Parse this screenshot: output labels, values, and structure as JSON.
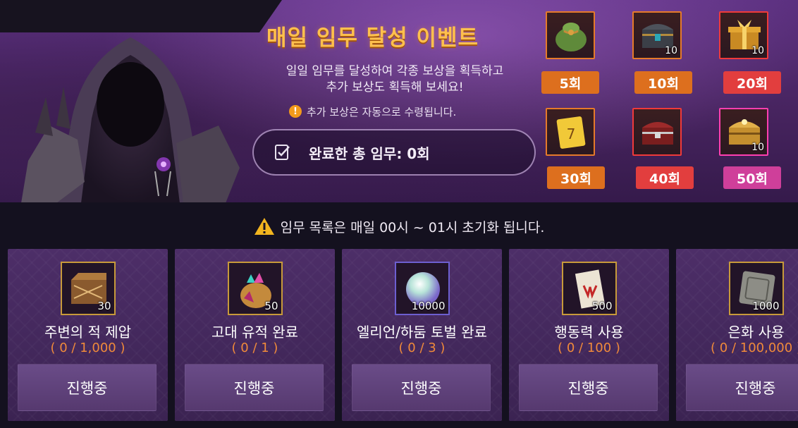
{
  "banner": {
    "title": "매일 임무 달성 이벤트",
    "description": "일일 임무를 달성하여 각종 보상을 획득하고\n추가 보상도 획득해 보세요!",
    "notice": "추가 보상은 자동으로 수령됩니다.",
    "total_label": "완료한 총 임무: 0회"
  },
  "rewards": [
    {
      "tag": "5회",
      "qty": "",
      "icon": "loot-pouch-icon",
      "color": "#dd6f1e"
    },
    {
      "tag": "10회",
      "qty": "10",
      "icon": "treasure-chest-icon",
      "color": "#dd6f1e"
    },
    {
      "tag": "20회",
      "qty": "10",
      "icon": "gift-box-icon",
      "color": "#e23e3e"
    },
    {
      "tag": "30회",
      "qty": "",
      "icon": "scroll-ticket-icon",
      "color": "#dd6f1e"
    },
    {
      "tag": "40회",
      "qty": "",
      "icon": "red-chest-icon",
      "color": "#e23e3e"
    },
    {
      "tag": "50회",
      "qty": "10",
      "icon": "golden-chest-icon",
      "color": "#cf3f9a"
    }
  ],
  "reset_notice": "임무 목록은 매일 00시 ~ 01시 초기화 됩니다.",
  "missions": [
    {
      "title": "주변의 적 제압",
      "progress": "( 0 / 1,000 )",
      "qty": "30",
      "button": "진행중",
      "icon": "wooden-box-icon"
    },
    {
      "title": "고대 유적 완료",
      "progress": "( 0 / 1 )",
      "qty": "50",
      "button": "진행중",
      "icon": "gem-pouch-icon"
    },
    {
      "title": "엘리언/하둠 토벌 완료",
      "progress": "( 0 / 3 )",
      "qty": "10000",
      "button": "진행중",
      "icon": "pearl-orb-icon"
    },
    {
      "title": "행동력 사용",
      "progress": "( 0 / 100 )",
      "qty": "500",
      "button": "진행중",
      "icon": "scroll-icon"
    },
    {
      "title": "은화 사용",
      "progress": "( 0 / 100,000 )",
      "qty": "1000",
      "button": "진행중",
      "icon": "silver-coin-icon"
    }
  ]
}
